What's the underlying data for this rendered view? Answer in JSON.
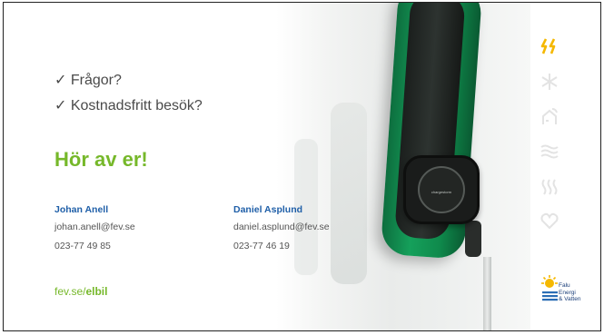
{
  "questions": [
    {
      "check": "✓",
      "text": "Frågor?"
    },
    {
      "check": "✓",
      "text": "Kostnadsfritt besök?"
    }
  ],
  "headline": "Hör av er!",
  "contacts": [
    {
      "name": "Johan Anell",
      "email": "johan.anell@fev.se",
      "phone": "023-77 49 85"
    },
    {
      "name": "Daniel Asplund",
      "email": "daniel.asplund@fev.se",
      "phone": "023-77 46 19"
    }
  ],
  "website": {
    "prefix": "fev.se/",
    "bold": "elbil"
  },
  "charger_label": "chargestorm",
  "logo": {
    "line1": "Falu",
    "line2": "Energi",
    "line3": "& Vatten"
  },
  "sidebar_icons": [
    "electricity-icon",
    "snowflake-icon",
    "house-signal-icon",
    "water-waves-icon",
    "heat-icon",
    "heart-icon"
  ],
  "colors": {
    "accent_green": "#76b82a",
    "name_blue": "#1f5fa8",
    "icon_yellow": "#f5b800",
    "icon_grey": "#e3e3e3"
  }
}
